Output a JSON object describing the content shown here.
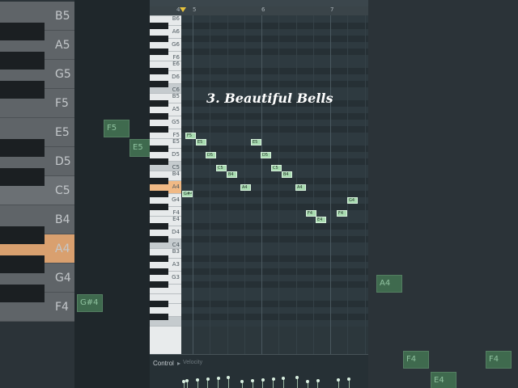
{
  "title_overlay": "3. Beautiful Bells",
  "timeline": {
    "bars": [
      "4",
      "5",
      "6",
      "7"
    ]
  },
  "keyboard_labels": [
    "B6",
    "A6",
    "G6",
    "F6",
    "E6",
    "D6",
    "C6",
    "B5",
    "A5",
    "G5",
    "F5",
    "E5",
    "D5",
    "C5",
    "B4",
    "A4",
    "G4",
    "F4",
    "E4",
    "D4",
    "C4",
    "B3",
    "A3",
    "G3"
  ],
  "notes": [
    {
      "label": "G#4",
      "start": 0.1,
      "len": 0.15,
      "pitch": "G#4"
    },
    {
      "label": "F5",
      "start": 0.15,
      "len": 0.15,
      "pitch": "F5"
    },
    {
      "label": "E5",
      "start": 0.3,
      "len": 0.15,
      "pitch": "E5"
    },
    {
      "label": "D5",
      "start": 0.45,
      "len": 0.15,
      "pitch": "D5"
    },
    {
      "label": "C5",
      "start": 0.6,
      "len": 0.15,
      "pitch": "C5"
    },
    {
      "label": "B4",
      "start": 0.75,
      "len": 0.15,
      "pitch": "B4"
    },
    {
      "label": "A4",
      "start": 0.95,
      "len": 0.15,
      "pitch": "A4"
    },
    {
      "label": "E5",
      "start": 1.1,
      "len": 0.15,
      "pitch": "E5"
    },
    {
      "label": "D5",
      "start": 1.25,
      "len": 0.15,
      "pitch": "D5"
    },
    {
      "label": "C5",
      "start": 1.4,
      "len": 0.15,
      "pitch": "C5"
    },
    {
      "label": "B4",
      "start": 1.55,
      "len": 0.15,
      "pitch": "B4"
    },
    {
      "label": "A4",
      "start": 1.75,
      "len": 0.15,
      "pitch": "A4"
    },
    {
      "label": "F4",
      "start": 1.9,
      "len": 0.15,
      "pitch": "F4"
    },
    {
      "label": "E4",
      "start": 2.05,
      "len": 0.15,
      "pitch": "E4"
    },
    {
      "label": "F4",
      "start": 2.35,
      "len": 0.15,
      "pitch": "F4"
    },
    {
      "label": "G4",
      "start": 2.5,
      "len": 0.15,
      "pitch": "G4"
    }
  ],
  "control": {
    "label": "Control",
    "arrow": "▸",
    "target": "Velocity"
  },
  "zoom_bg": {
    "left_labels": [
      "B5",
      "A5",
      "G5",
      "F5",
      "E5",
      "D5",
      "C5",
      "B4",
      "A4",
      "G4",
      "F4"
    ],
    "left_notes": [
      "F5",
      "E5",
      "G#4"
    ],
    "right_notes": [
      "A4",
      "F4",
      "F4",
      "E4"
    ]
  },
  "colors": {
    "note_fill": "#a8dbb0",
    "selected_key": "#f0b985",
    "accent_playhead": "#e7c33c"
  }
}
